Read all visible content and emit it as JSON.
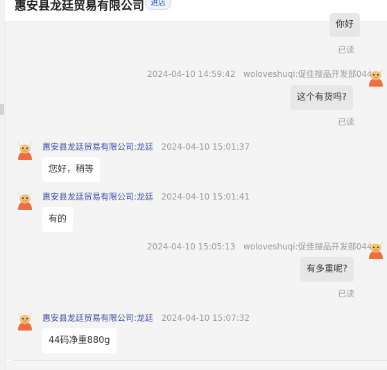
{
  "header": {
    "shop_name": "惠安县龙廷贸易有限公司",
    "enter_label": "进店"
  },
  "messages": [
    {
      "id": "m1",
      "side": "right",
      "text": "你好",
      "read": "已读"
    },
    {
      "id": "m2",
      "side": "right",
      "time": "2024-04-10 14:59:42",
      "sender": "woloveshuqi:促佳搜品开发部044",
      "text": "这个有货吗?",
      "read": "已读"
    },
    {
      "id": "m3",
      "side": "left",
      "sender": "惠安县龙廷贸易有限公司:龙廷",
      "time": "2024-04-10 15:01:37",
      "text": "您好，稍等"
    },
    {
      "id": "m4",
      "side": "left",
      "sender": "惠安县龙廷贸易有限公司:龙廷",
      "time": "2024-04-10 15:01:41",
      "text": "有的"
    },
    {
      "id": "m5",
      "side": "right",
      "time": "2024-04-10 15:05:13",
      "sender": "woloveshuqi:促佳搜品开发部044",
      "text": "有多重呢?",
      "read": "已读"
    },
    {
      "id": "m6",
      "side": "left",
      "sender": "惠安县龙廷贸易有限公司:龙廷",
      "time": "2024-04-10 15:07:32",
      "text": "44码净重880g"
    }
  ],
  "colors": {
    "right_bubble": "#e7e7e7",
    "left_bubble": "#ffffff",
    "sender_name": "#3d4aa3",
    "chat_bg": "#f4f4f4"
  }
}
